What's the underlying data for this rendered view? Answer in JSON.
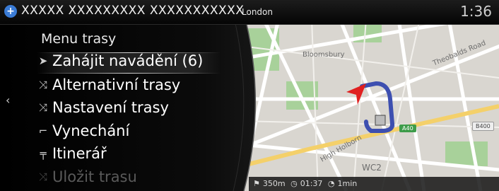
{
  "topbar": {
    "title": "XXXXX XXXXXXXXX XXXXXXXXXXX",
    "city": "London",
    "clock": "1:36"
  },
  "menu": {
    "header": "Menu trasy",
    "items": [
      {
        "label": "Zahájit navádění (6)",
        "icon": "navigation-arrow-icon",
        "selected": true
      },
      {
        "label": "Alternativní trasy",
        "icon": "alternative-routes-icon"
      },
      {
        "label": "Nastavení trasy",
        "icon": "route-settings-icon"
      },
      {
        "label": "Vynechání",
        "icon": "avoid-icon"
      },
      {
        "label": "Itinerář",
        "icon": "itinerary-icon"
      },
      {
        "label": "Uložit trasu",
        "icon": "save-route-icon",
        "disabled": true
      }
    ]
  },
  "map": {
    "labels": {
      "bloomsbury": "Bloomsbury",
      "theobalds": "Theobalds Road",
      "holborn": "High Holborn",
      "wc2": "WC2"
    },
    "shields": {
      "a40": "A40",
      "b400": "B400"
    }
  },
  "status": {
    "distance": "350m",
    "eta": "01:37",
    "duration": "1min"
  },
  "colors": {
    "route": "#3d4fb0",
    "position_arrow": "#e02020",
    "selection_line": "#ffffff",
    "map_bg": "#d9d6d0"
  }
}
